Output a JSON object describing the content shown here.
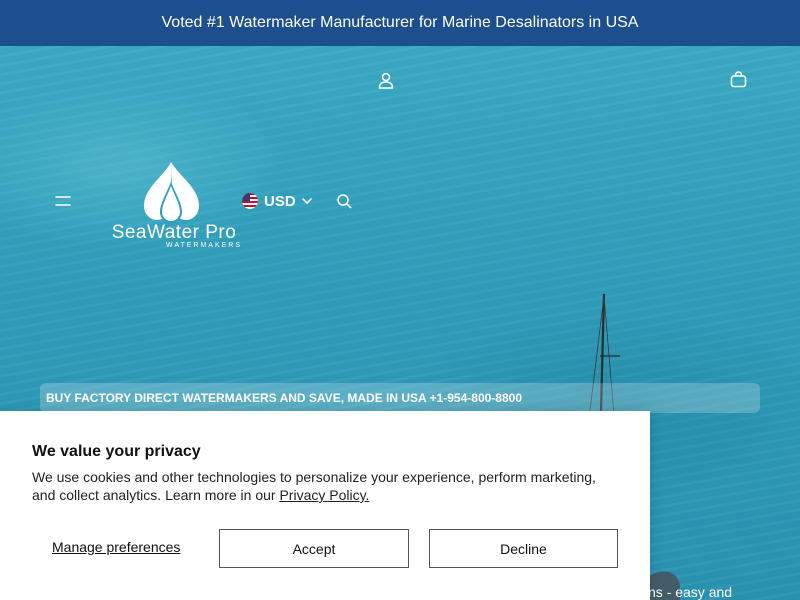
{
  "announcement": {
    "text": "Voted #1 Watermaker Manufacturer for Marine Desalinators in USA"
  },
  "header": {
    "icons": {
      "account": "user-icon",
      "cart": "shopping-bag-icon",
      "menu": "hamburger-menu-icon",
      "search": "search-icon",
      "currency_chevron": "chevron-down-icon",
      "flag": "us-flag-icon"
    },
    "logo": {
      "name": "SeaWater Pro",
      "tagline": "WATERMAKERS"
    },
    "currency": {
      "selected": "USD"
    }
  },
  "promo": {
    "text": "BUY FACTORY DIRECT WATERMAKERS AND SAVE, MADE IN USA +1-954-800-8800"
  },
  "hero": {
    "partial_text": "ns - easy and"
  },
  "cookie": {
    "title": "We value your privacy",
    "body": "We use cookies and other technologies to personalize your experience, perform marketing, and collect analytics. Learn more in our ",
    "link": "Privacy Policy.",
    "manage_label": "Manage preferences",
    "accept_label": "Accept",
    "decline_label": "Decline"
  },
  "colors": {
    "announcement_bg": "#1d4f8e",
    "sea": "#2f9fba",
    "cookie_bg": "#ffffff",
    "text_dark": "#111111"
  }
}
